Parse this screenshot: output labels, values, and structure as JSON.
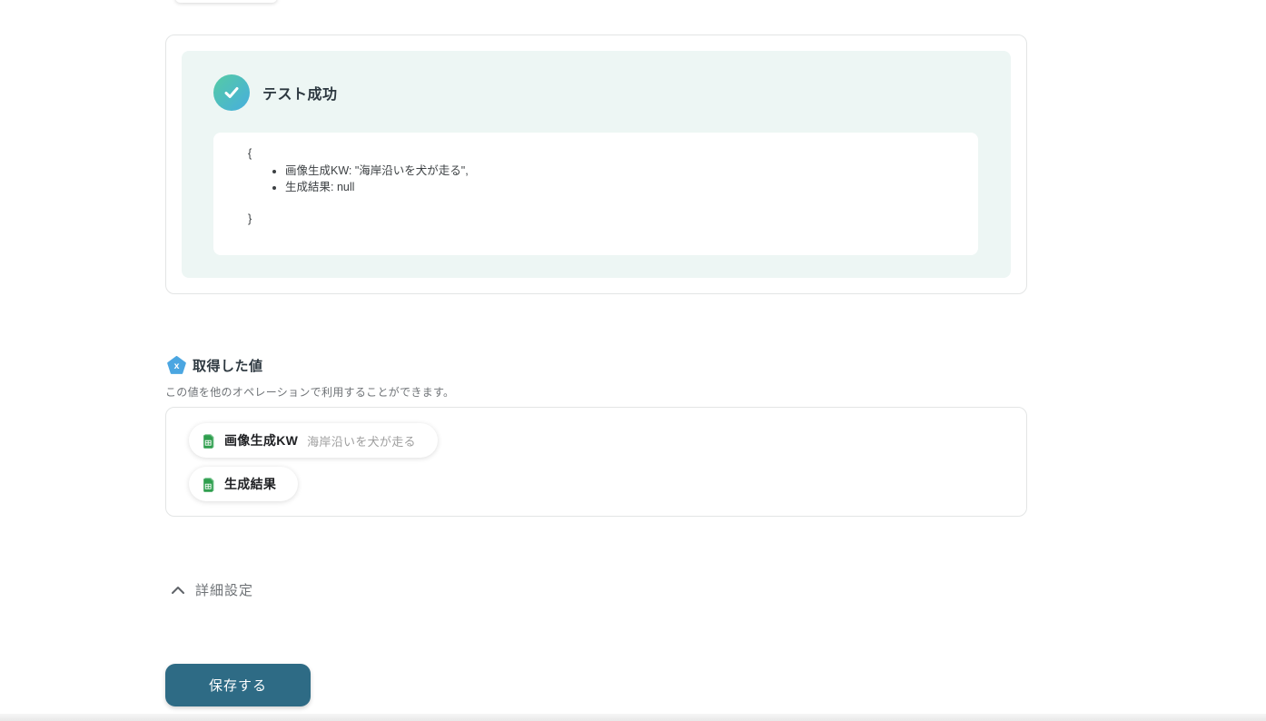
{
  "test_result": {
    "title": "テスト成功",
    "icon": "check-circle",
    "code": {
      "brace_open": "{",
      "items": [
        "画像生成KW: \"海岸沿いを犬が走る\",",
        "生成結果: null"
      ],
      "brace_close": "}"
    }
  },
  "retrieved_values": {
    "badge_letter": "x",
    "title": "取得した値",
    "description": "この値を他のオペレーションで利用することができます。",
    "chips": [
      {
        "icon": "spreadsheet",
        "label": "画像生成KW",
        "value": "海岸沿いを犬が走る"
      },
      {
        "icon": "spreadsheet",
        "label": "生成結果",
        "value": ""
      }
    ]
  },
  "advanced_settings": {
    "label": "詳細設定",
    "state": "expanded"
  },
  "footer": {
    "save_label": "保存する"
  },
  "colors": {
    "success_gradient_start": "#55cba4",
    "success_gradient_end": "#47aede",
    "result_panel_bg": "#edf6f4",
    "badge_blue": "#4ba6e1",
    "sheet_green": "#2f9e4e",
    "save_button_bg": "#2e6b85",
    "card_border": "#e3e5e5"
  }
}
